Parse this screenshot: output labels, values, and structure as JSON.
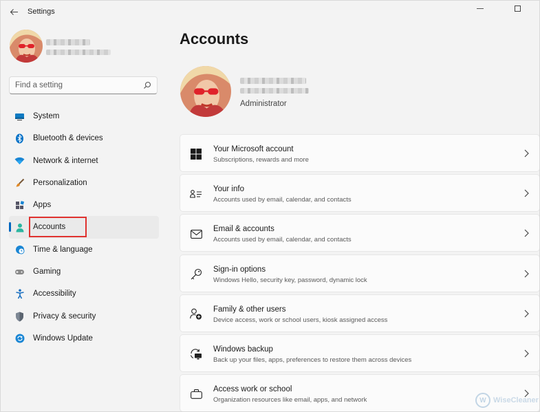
{
  "window": {
    "title": "Settings"
  },
  "sidebar": {
    "search_placeholder": "Find a setting",
    "items": [
      {
        "label": "System",
        "icon": "monitor-icon",
        "active": false
      },
      {
        "label": "Bluetooth & devices",
        "icon": "bluetooth-icon",
        "active": false
      },
      {
        "label": "Network & internet",
        "icon": "wifi-icon",
        "active": false
      },
      {
        "label": "Personalization",
        "icon": "brush-icon",
        "active": false
      },
      {
        "label": "Apps",
        "icon": "apps-icon",
        "active": false
      },
      {
        "label": "Accounts",
        "icon": "person-icon",
        "active": true
      },
      {
        "label": "Time & language",
        "icon": "globe-clock-icon",
        "active": false
      },
      {
        "label": "Gaming",
        "icon": "gamepad-icon",
        "active": false
      },
      {
        "label": "Accessibility",
        "icon": "accessibility-icon",
        "active": false
      },
      {
        "label": "Privacy & security",
        "icon": "shield-icon",
        "active": false
      },
      {
        "label": "Windows Update",
        "icon": "update-icon",
        "active": false
      }
    ]
  },
  "main": {
    "title": "Accounts",
    "account_role": "Administrator",
    "cards": [
      {
        "title": "Your Microsoft account",
        "subtitle": "Subscriptions, rewards and more",
        "icon": "windows-logo-icon"
      },
      {
        "title": "Your info",
        "subtitle": "Accounts used by email, calendar, and contacts",
        "icon": "contact-card-icon"
      },
      {
        "title": "Email & accounts",
        "subtitle": "Accounts used by email, calendar, and contacts",
        "icon": "mail-icon"
      },
      {
        "title": "Sign-in options",
        "subtitle": "Windows Hello, security key, password, dynamic lock",
        "icon": "key-icon"
      },
      {
        "title": "Family & other users",
        "subtitle": "Device access, work or school users, kiosk assigned access",
        "icon": "add-user-icon"
      },
      {
        "title": "Windows backup",
        "subtitle": "Back up your files, apps, preferences to restore them across devices",
        "icon": "backup-icon"
      },
      {
        "title": "Access work or school",
        "subtitle": "Organization resources like email, apps, and network",
        "icon": "briefcase-icon"
      }
    ]
  },
  "watermark": {
    "text": "WiseCleaner"
  },
  "colors": {
    "accent": "#0067c0",
    "highlight": "#e0322f",
    "background": "#f3f3f3",
    "card": "#fbfbfb"
  }
}
